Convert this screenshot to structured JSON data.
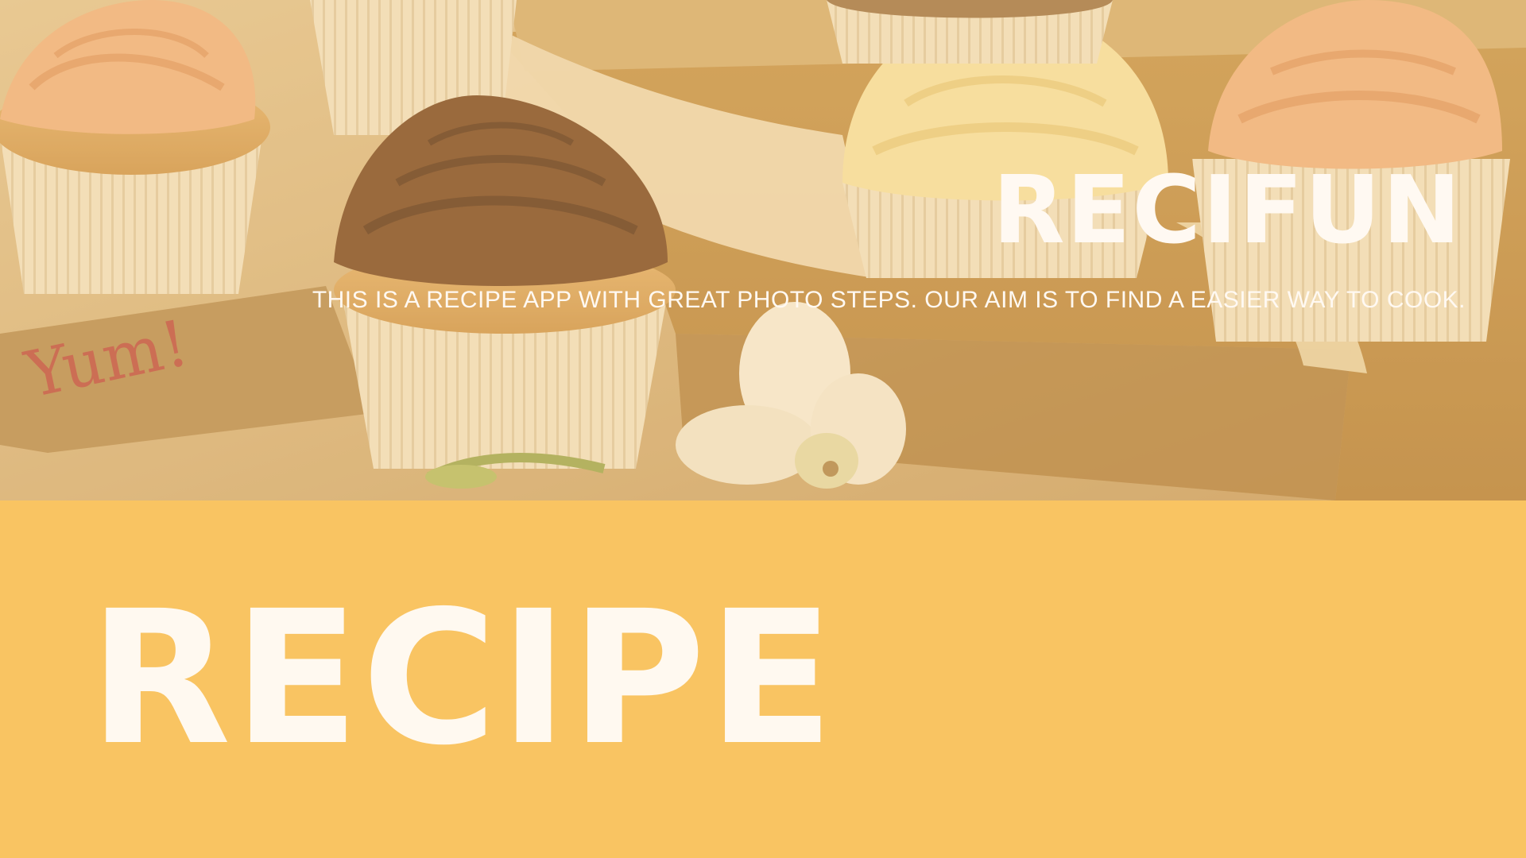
{
  "hero": {
    "brand": "RECIFUN",
    "tagline": "THIS IS A RECIPE APP WITH GREAT PHOTO STEPS. OUR AIM IS TO FIND A EASIER WAY TO COOK.",
    "tag_note": "Yum!"
  },
  "band": {
    "title": "RECIPE"
  },
  "colors": {
    "band_background": "#f9c462",
    "text_light": "#fff9f2",
    "chocolate_frosting": "#7a4a2a",
    "vanilla_frosting": "#fbeab0",
    "peach_frosting": "#f4b98c",
    "note_ink": "#c0504a"
  },
  "icons": [
    "cupcake-illustration",
    "orchid-flower-illustration",
    "paper-tag-illustration"
  ]
}
